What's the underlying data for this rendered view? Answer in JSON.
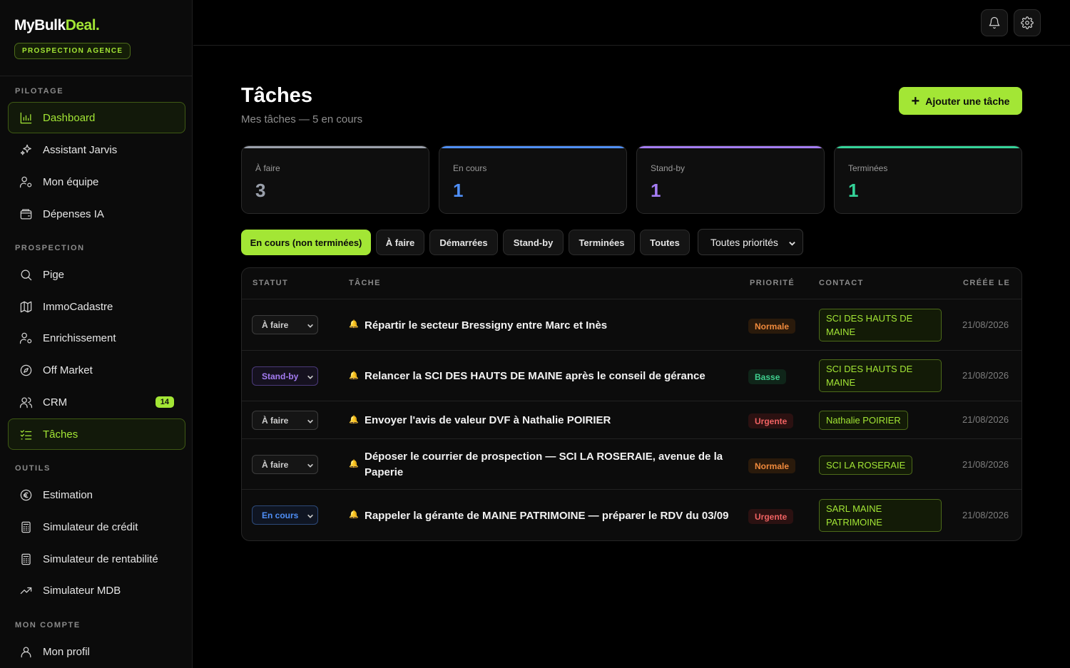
{
  "brand": {
    "logo_main": "MyBulk",
    "logo_accent": "Deal",
    "logo_dot": ".",
    "agency_badge": "PROSPECTION AGENCE"
  },
  "sidebar": {
    "sections": {
      "pilotage": "PILOTAGE",
      "prospection": "PROSPECTION",
      "outils": "OUTILS",
      "compte": "MON COMPTE"
    },
    "items": [
      {
        "label": "Dashboard",
        "icon": "bar-chart-icon"
      },
      {
        "label": "Assistant Jarvis",
        "icon": "sparkles-icon"
      },
      {
        "label": "Mon équipe",
        "icon": "user-gear-icon"
      },
      {
        "label": "Dépenses IA",
        "icon": "wallet-icon"
      },
      {
        "label": "Pige",
        "icon": "search-icon"
      },
      {
        "label": "ImmoCadastre",
        "icon": "map-icon"
      },
      {
        "label": "Enrichissement",
        "icon": "user-gear-icon"
      },
      {
        "label": "Off Market",
        "icon": "compass-icon"
      },
      {
        "label": "CRM",
        "icon": "users-icon",
        "count": "14"
      },
      {
        "label": "Tâches",
        "icon": "checklist-icon"
      },
      {
        "label": "Estimation",
        "icon": "euro-icon"
      },
      {
        "label": "Simulateur de crédit",
        "icon": "calculator-icon"
      },
      {
        "label": "Simulateur de rentabilité",
        "icon": "calculator-icon"
      },
      {
        "label": "Simulateur MDB",
        "icon": "trend-up-icon"
      },
      {
        "label": "Mon profil",
        "icon": "user-icon"
      }
    ]
  },
  "header": {
    "title": "Tâches",
    "subtitle": "Mes tâches — 5 en cours",
    "add_button": "Ajouter une tâche"
  },
  "stats": [
    {
      "label": "À faire",
      "value": "3",
      "color": "#9aa0ab"
    },
    {
      "label": "En cours",
      "value": "1",
      "color": "#4f8ff7"
    },
    {
      "label": "Stand-by",
      "value": "1",
      "color": "#a47cf3"
    },
    {
      "label": "Terminées",
      "value": "1",
      "color": "#34d399"
    }
  ],
  "filters": [
    "En cours (non terminées)",
    "À faire",
    "Démarrées",
    "Stand-by",
    "Terminées",
    "Toutes"
  ],
  "priority_filter": "Toutes priorités",
  "table": {
    "columns": [
      "STATUT",
      "TÂCHE",
      "PRIORITÉ",
      "CONTACT",
      "CRÉÉE LE"
    ],
    "rows": [
      {
        "status": "À faire",
        "task": "Répartir le secteur Bressigny entre Marc et Inès",
        "priority": "Normale",
        "contact": "SCI DES HAUTS DE MAINE",
        "date": "21/08/2026"
      },
      {
        "status": "Stand-by",
        "task": "Relancer la SCI DES HAUTS DE MAINE après le conseil de gérance",
        "priority": "Basse",
        "contact": "SCI DES HAUTS DE MAINE",
        "date": "21/08/2026"
      },
      {
        "status": "À faire",
        "task": "Envoyer l'avis de valeur DVF à Nathalie POIRIER",
        "priority": "Urgente",
        "contact": "Nathalie POIRIER",
        "date": "21/08/2026"
      },
      {
        "status": "À faire",
        "task": "Déposer le courrier de prospection — SCI LA ROSERAIE, avenue de la Paperie",
        "priority": "Normale",
        "contact": "SCI LA ROSERAIE",
        "date": "21/08/2026"
      },
      {
        "status": "En cours",
        "task": "Rappeler la gérante de MAINE PATRIMOINE — préparer le RDV du 03/09",
        "priority": "Urgente",
        "contact": "SARL MAINE PATRIMOINE",
        "date": "21/08/2026"
      }
    ]
  },
  "colors": {
    "accent": "#a3e635",
    "status_afaire": "#cfcfcf",
    "status_standby": "#a47cf3",
    "status_encours": "#4f8ff7"
  }
}
